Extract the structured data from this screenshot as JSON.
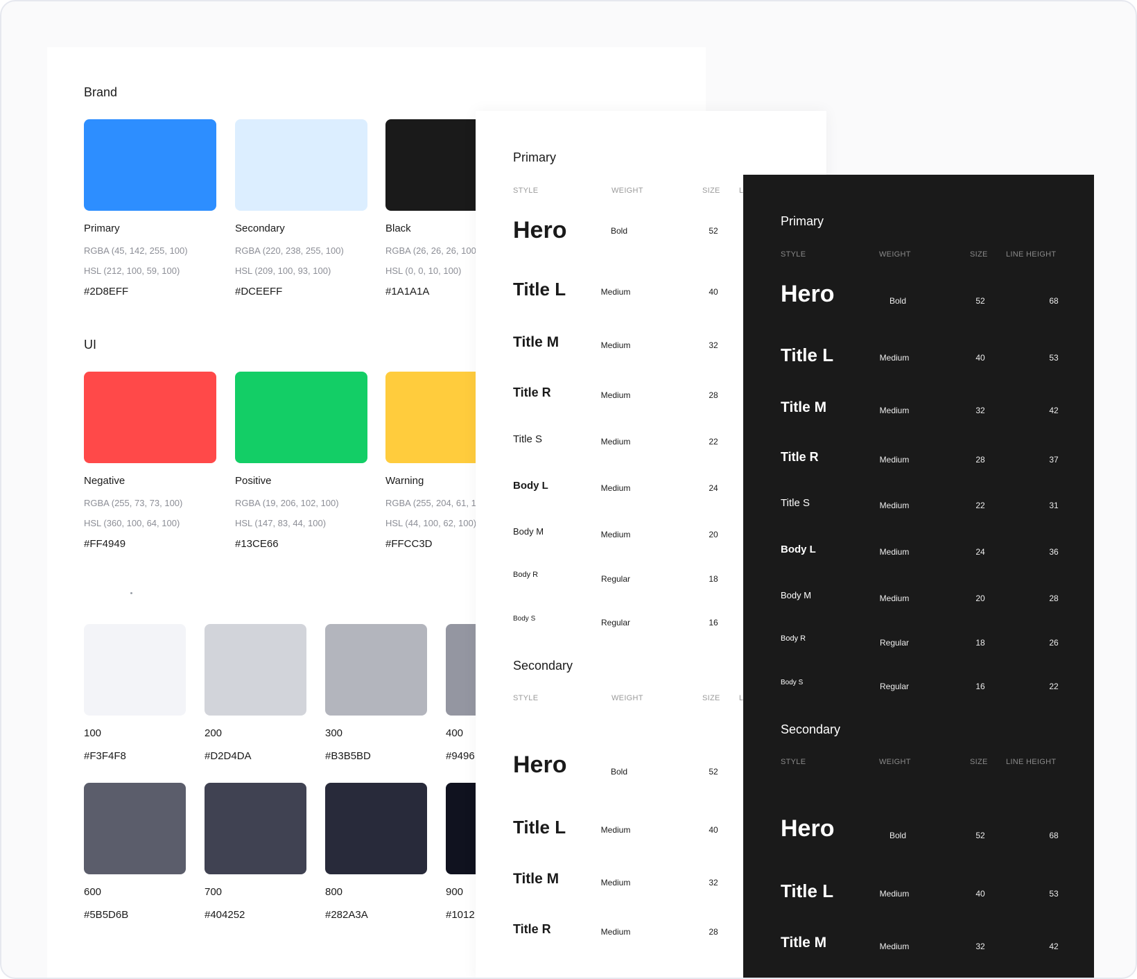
{
  "colors_card": {
    "brand": {
      "heading": "Brand",
      "swatches": [
        {
          "name": "Primary",
          "rgba": "RGBA (45, 142, 255, 100)",
          "hsl": "HSL (212, 100, 59, 100)",
          "hex": "#2D8EFF",
          "color": "#2D8EFF"
        },
        {
          "name": "Secondary",
          "rgba": "RGBA (220, 238, 255, 100)",
          "hsl": "HSL (209, 100, 93, 100)",
          "hex": "#DCEEFF",
          "color": "#DCEEFF"
        },
        {
          "name": "Black",
          "rgba": "RGBA (26, 26, 26, 100)",
          "hsl": "HSL (0, 0, 10, 100)",
          "hex": "#1A1A1A",
          "color": "#1A1A1A"
        }
      ]
    },
    "ui": {
      "heading": "UI",
      "swatches": [
        {
          "name": "Negative",
          "rgba": "RGBA (255, 73, 73, 100)",
          "hsl": "HSL (360, 100, 64, 100)",
          "hex": "#FF4949",
          "color": "#FF4949"
        },
        {
          "name": "Positive",
          "rgba": "RGBA (19, 206, 102, 100)",
          "hsl": "HSL (147, 83, 44, 100)",
          "hex": "#13CE66",
          "color": "#13CE66"
        },
        {
          "name": "Warning",
          "rgba": "RGBA (255, 204, 61, 10",
          "hsl": "HSL (44, 100, 62, 100)",
          "hex": "#FFCC3D",
          "color": "#FFCC3D"
        }
      ]
    },
    "greys_top": [
      {
        "label": "100",
        "hex": "#F3F4F8",
        "color": "#F3F4F8"
      },
      {
        "label": "200",
        "hex": "#D2D4DA",
        "color": "#D2D4DA"
      },
      {
        "label": "300",
        "hex": "#B3B5BD",
        "color": "#B3B5BD"
      },
      {
        "label": "400",
        "hex": "#9496",
        "color": "#9496A1"
      }
    ],
    "greys_bottom": [
      {
        "label": "600",
        "hex": "#5B5D6B",
        "color": "#5B5D6B"
      },
      {
        "label": "700",
        "hex": "#404252",
        "color": "#404252"
      },
      {
        "label": "800",
        "hex": "#282A3A",
        "color": "#282A3A"
      },
      {
        "label": "900",
        "hex": "#1012",
        "color": "#10121F"
      }
    ]
  },
  "type_light": {
    "primary_heading": "Primary",
    "secondary_heading": "Secondary",
    "columns": {
      "style": "STYLE",
      "weight": "WEIGHT",
      "size": "SIZE",
      "lh_partial": "L"
    },
    "primary_rows": [
      {
        "style": "Hero",
        "weight": "Bold",
        "size": "52"
      },
      {
        "style": "Title L",
        "weight": "Medium",
        "size": "40"
      },
      {
        "style": "Title M",
        "weight": "Medium",
        "size": "32"
      },
      {
        "style": "Title R",
        "weight": "Medium",
        "size": "28"
      },
      {
        "style": "Title S",
        "weight": "Medium",
        "size": "22"
      },
      {
        "style": "Body L",
        "weight": "Medium",
        "size": "24"
      },
      {
        "style": "Body M",
        "weight": "Medium",
        "size": "20"
      },
      {
        "style": "Body R",
        "weight": "Regular",
        "size": "18"
      },
      {
        "style": "Body S",
        "weight": "Regular",
        "size": "16"
      }
    ],
    "secondary_rows": [
      {
        "style": "Hero",
        "weight": "Bold",
        "size": "52"
      },
      {
        "style": "Title L",
        "weight": "Medium",
        "size": "40"
      },
      {
        "style": "Title M",
        "weight": "Medium",
        "size": "32"
      },
      {
        "style": "Title R",
        "weight": "Medium",
        "size": "28"
      }
    ]
  },
  "type_dark": {
    "primary_heading": "Primary",
    "secondary_heading": "Secondary",
    "columns": {
      "style": "STYLE",
      "weight": "WEIGHT",
      "size": "SIZE",
      "line_height": "LINE HEIGHT"
    },
    "primary_rows": [
      {
        "style": "Hero",
        "weight": "Bold",
        "size": "52",
        "lh": "68"
      },
      {
        "style": "Title L",
        "weight": "Medium",
        "size": "40",
        "lh": "53"
      },
      {
        "style": "Title M",
        "weight": "Medium",
        "size": "32",
        "lh": "42"
      },
      {
        "style": "Title R",
        "weight": "Medium",
        "size": "28",
        "lh": "37"
      },
      {
        "style": "Title S",
        "weight": "Medium",
        "size": "22",
        "lh": "31"
      },
      {
        "style": "Body L",
        "weight": "Medium",
        "size": "24",
        "lh": "36"
      },
      {
        "style": "Body M",
        "weight": "Medium",
        "size": "20",
        "lh": "28"
      },
      {
        "style": "Body R",
        "weight": "Regular",
        "size": "18",
        "lh": "26"
      },
      {
        "style": "Body S",
        "weight": "Regular",
        "size": "16",
        "lh": "22"
      }
    ],
    "secondary_rows": [
      {
        "style": "Hero",
        "weight": "Bold",
        "size": "52",
        "lh": "68"
      },
      {
        "style": "Title L",
        "weight": "Medium",
        "size": "40",
        "lh": "53"
      },
      {
        "style": "Title M",
        "weight": "Medium",
        "size": "32",
        "lh": "42"
      }
    ]
  }
}
